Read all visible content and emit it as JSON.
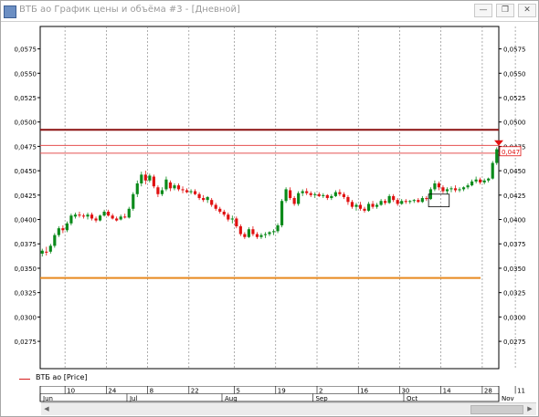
{
  "window": {
    "title": "ВТБ ао График цены и объёма #3 - [Дневной]",
    "buttons": {
      "min": "—",
      "restore": "❐",
      "close": "✕"
    }
  },
  "legend": {
    "label": "ВТБ ао [Price]"
  },
  "chart_data": {
    "type": "candlestick",
    "series_name": "ВТБ ао [Price]",
    "ylim": [
      0.0247,
      0.0598
    ],
    "y_ticks": [
      {
        "v": 0.0575,
        "label": "0,0575"
      },
      {
        "v": 0.055,
        "label": "0,0550"
      },
      {
        "v": 0.0525,
        "label": "0,0525"
      },
      {
        "v": 0.05,
        "label": "0,0500"
      },
      {
        "v": 0.0475,
        "label": "0,0475"
      },
      {
        "v": 0.045,
        "label": "0,0450"
      },
      {
        "v": 0.0425,
        "label": "0,0425"
      },
      {
        "v": 0.04,
        "label": "0,0400"
      },
      {
        "v": 0.0375,
        "label": "0,0375"
      },
      {
        "v": 0.035,
        "label": "0,0350"
      },
      {
        "v": 0.0325,
        "label": "0,0325"
      },
      {
        "v": 0.03,
        "label": "0,0300"
      },
      {
        "v": 0.0275,
        "label": "0,0275"
      }
    ],
    "x_day_labels": [
      {
        "i": 6,
        "label": "10"
      },
      {
        "i": 16,
        "label": "24"
      },
      {
        "i": 26,
        "label": "8"
      },
      {
        "i": 36,
        "label": "22"
      },
      {
        "i": 47,
        "label": "5"
      },
      {
        "i": 57,
        "label": "19"
      },
      {
        "i": 67,
        "label": "2"
      },
      {
        "i": 77,
        "label": "16"
      },
      {
        "i": 87,
        "label": "30"
      },
      {
        "i": 97,
        "label": "14"
      },
      {
        "i": 107,
        "label": "28"
      },
      {
        "i": 115,
        "label": "11"
      }
    ],
    "x_month_labels": [
      {
        "i": 0,
        "label": "Jun"
      },
      {
        "i": 21,
        "label": "Jul"
      },
      {
        "i": 44,
        "label": "Aug"
      },
      {
        "i": 66,
        "label": "Sep"
      },
      {
        "i": 88,
        "label": "Oct"
      },
      {
        "i": 111,
        "label": "Nov"
      }
    ],
    "hlines": [
      {
        "value": 0.0492,
        "color": "#8b1010",
        "width": 2
      },
      {
        "value": 0.0476,
        "color": "#e45050",
        "width": 1
      },
      {
        "value": 0.0468,
        "color": "#e45050",
        "width": 1
      },
      {
        "value": 0.034,
        "color": "#e8891e",
        "width": 2
      }
    ],
    "last_price_label": "0,047",
    "last_price_value": 0.047,
    "up_color": "#0a8a1a",
    "down_color": "#e01010",
    "selection_box": {
      "i_start": 94,
      "i_end": 99,
      "y_low": 0.0413,
      "y_high": 0.0426
    },
    "candles": [
      {
        "o": 0.0365,
        "h": 0.037,
        "l": 0.0362,
        "c": 0.0368
      },
      {
        "o": 0.0367,
        "h": 0.0372,
        "l": 0.0363,
        "c": 0.0366
      },
      {
        "o": 0.0367,
        "h": 0.0375,
        "l": 0.0365,
        "c": 0.0373
      },
      {
        "o": 0.0373,
        "h": 0.0386,
        "l": 0.0371,
        "c": 0.0384
      },
      {
        "o": 0.0384,
        "h": 0.0393,
        "l": 0.0382,
        "c": 0.0391
      },
      {
        "o": 0.0391,
        "h": 0.0394,
        "l": 0.0386,
        "c": 0.0389
      },
      {
        "o": 0.0389,
        "h": 0.0398,
        "l": 0.0387,
        "c": 0.0396
      },
      {
        "o": 0.0396,
        "h": 0.0406,
        "l": 0.0394,
        "c": 0.0404
      },
      {
        "o": 0.0403,
        "h": 0.0407,
        "l": 0.0401,
        "c": 0.0405
      },
      {
        "o": 0.0405,
        "h": 0.0408,
        "l": 0.0402,
        "c": 0.0404
      },
      {
        "o": 0.0404,
        "h": 0.0406,
        "l": 0.0401,
        "c": 0.0403
      },
      {
        "o": 0.0403,
        "h": 0.0407,
        "l": 0.04,
        "c": 0.0405
      },
      {
        "o": 0.0405,
        "h": 0.0407,
        "l": 0.0399,
        "c": 0.0401
      },
      {
        "o": 0.0401,
        "h": 0.0403,
        "l": 0.0397,
        "c": 0.0399
      },
      {
        "o": 0.0399,
        "h": 0.0405,
        "l": 0.0398,
        "c": 0.0404
      },
      {
        "o": 0.0404,
        "h": 0.041,
        "l": 0.0403,
        "c": 0.0408
      },
      {
        "o": 0.0408,
        "h": 0.041,
        "l": 0.0403,
        "c": 0.0404
      },
      {
        "o": 0.0404,
        "h": 0.0406,
        "l": 0.04,
        "c": 0.0401
      },
      {
        "o": 0.0401,
        "h": 0.0403,
        "l": 0.0398,
        "c": 0.0399
      },
      {
        "o": 0.04,
        "h": 0.0405,
        "l": 0.0399,
        "c": 0.0403
      },
      {
        "o": 0.0403,
        "h": 0.0406,
        "l": 0.0401,
        "c": 0.0402
      },
      {
        "o": 0.0402,
        "h": 0.0413,
        "l": 0.0401,
        "c": 0.0411
      },
      {
        "o": 0.0411,
        "h": 0.0428,
        "l": 0.0409,
        "c": 0.0426
      },
      {
        "o": 0.0426,
        "h": 0.044,
        "l": 0.0423,
        "c": 0.0437
      },
      {
        "o": 0.0437,
        "h": 0.0449,
        "l": 0.0434,
        "c": 0.0446
      },
      {
        "o": 0.0446,
        "h": 0.045,
        "l": 0.0436,
        "c": 0.044
      },
      {
        "o": 0.044,
        "h": 0.0447,
        "l": 0.0438,
        "c": 0.0445
      },
      {
        "o": 0.0444,
        "h": 0.0446,
        "l": 0.0432,
        "c": 0.0434
      },
      {
        "o": 0.0433,
        "h": 0.0435,
        "l": 0.0423,
        "c": 0.0426
      },
      {
        "o": 0.0426,
        "h": 0.0433,
        "l": 0.0424,
        "c": 0.043
      },
      {
        "o": 0.0431,
        "h": 0.0444,
        "l": 0.0429,
        "c": 0.0441
      },
      {
        "o": 0.0438,
        "h": 0.044,
        "l": 0.0429,
        "c": 0.0432
      },
      {
        "o": 0.0432,
        "h": 0.0437,
        "l": 0.043,
        "c": 0.0435
      },
      {
        "o": 0.0435,
        "h": 0.0437,
        "l": 0.0429,
        "c": 0.0431
      },
      {
        "o": 0.0431,
        "h": 0.0434,
        "l": 0.0427,
        "c": 0.043
      },
      {
        "o": 0.043,
        "h": 0.0432,
        "l": 0.0427,
        "c": 0.0428
      },
      {
        "o": 0.0428,
        "h": 0.0431,
        "l": 0.0426,
        "c": 0.0429
      },
      {
        "o": 0.0429,
        "h": 0.0431,
        "l": 0.0425,
        "c": 0.0426
      },
      {
        "o": 0.0426,
        "h": 0.0428,
        "l": 0.042,
        "c": 0.0422
      },
      {
        "o": 0.0422,
        "h": 0.0425,
        "l": 0.0418,
        "c": 0.042
      },
      {
        "o": 0.042,
        "h": 0.0424,
        "l": 0.0417,
        "c": 0.0423
      },
      {
        "o": 0.042,
        "h": 0.0422,
        "l": 0.0413,
        "c": 0.0415
      },
      {
        "o": 0.0415,
        "h": 0.0417,
        "l": 0.0409,
        "c": 0.0411
      },
      {
        "o": 0.0411,
        "h": 0.0413,
        "l": 0.0406,
        "c": 0.0408
      },
      {
        "o": 0.0408,
        "h": 0.041,
        "l": 0.0403,
        "c": 0.0405
      },
      {
        "o": 0.0405,
        "h": 0.0407,
        "l": 0.0398,
        "c": 0.04
      },
      {
        "o": 0.04,
        "h": 0.0404,
        "l": 0.0396,
        "c": 0.0401
      },
      {
        "o": 0.0401,
        "h": 0.0403,
        "l": 0.0391,
        "c": 0.0393
      },
      {
        "o": 0.0393,
        "h": 0.0395,
        "l": 0.0383,
        "c": 0.0385
      },
      {
        "o": 0.0385,
        "h": 0.0387,
        "l": 0.038,
        "c": 0.0382
      },
      {
        "o": 0.0382,
        "h": 0.0392,
        "l": 0.0381,
        "c": 0.039
      },
      {
        "o": 0.039,
        "h": 0.0393,
        "l": 0.0383,
        "c": 0.0385
      },
      {
        "o": 0.0385,
        "h": 0.0387,
        "l": 0.038,
        "c": 0.0382
      },
      {
        "o": 0.0382,
        "h": 0.0386,
        "l": 0.038,
        "c": 0.0384
      },
      {
        "o": 0.0384,
        "h": 0.0387,
        "l": 0.0381,
        "c": 0.0385
      },
      {
        "o": 0.0385,
        "h": 0.0388,
        "l": 0.0383,
        "c": 0.0387
      },
      {
        "o": 0.0387,
        "h": 0.039,
        "l": 0.0384,
        "c": 0.0388
      },
      {
        "o": 0.0388,
        "h": 0.0396,
        "l": 0.0386,
        "c": 0.0394
      },
      {
        "o": 0.0394,
        "h": 0.0421,
        "l": 0.0392,
        "c": 0.0419
      },
      {
        "o": 0.0419,
        "h": 0.0433,
        "l": 0.0417,
        "c": 0.0431
      },
      {
        "o": 0.043,
        "h": 0.0433,
        "l": 0.042,
        "c": 0.0422
      },
      {
        "o": 0.0422,
        "h": 0.0424,
        "l": 0.0414,
        "c": 0.0416
      },
      {
        "o": 0.0416,
        "h": 0.0429,
        "l": 0.0414,
        "c": 0.0427
      },
      {
        "o": 0.0427,
        "h": 0.0431,
        "l": 0.0424,
        "c": 0.0429
      },
      {
        "o": 0.0429,
        "h": 0.0432,
        "l": 0.0425,
        "c": 0.0427
      },
      {
        "o": 0.0427,
        "h": 0.0429,
        "l": 0.0423,
        "c": 0.0425
      },
      {
        "o": 0.0425,
        "h": 0.0428,
        "l": 0.0422,
        "c": 0.0426
      },
      {
        "o": 0.0426,
        "h": 0.0428,
        "l": 0.0423,
        "c": 0.0424
      },
      {
        "o": 0.0424,
        "h": 0.0427,
        "l": 0.0422,
        "c": 0.0425
      },
      {
        "o": 0.0425,
        "h": 0.0426,
        "l": 0.042,
        "c": 0.0422
      },
      {
        "o": 0.0422,
        "h": 0.0426,
        "l": 0.042,
        "c": 0.0424
      },
      {
        "o": 0.0424,
        "h": 0.043,
        "l": 0.0423,
        "c": 0.0428
      },
      {
        "o": 0.0428,
        "h": 0.0431,
        "l": 0.0424,
        "c": 0.0426
      },
      {
        "o": 0.0426,
        "h": 0.0428,
        "l": 0.0421,
        "c": 0.0423
      },
      {
        "o": 0.0423,
        "h": 0.0425,
        "l": 0.0415,
        "c": 0.0418
      },
      {
        "o": 0.0418,
        "h": 0.042,
        "l": 0.0411,
        "c": 0.0413
      },
      {
        "o": 0.0413,
        "h": 0.0417,
        "l": 0.0409,
        "c": 0.0415
      },
      {
        "o": 0.0415,
        "h": 0.0418,
        "l": 0.0409,
        "c": 0.0411
      },
      {
        "o": 0.0411,
        "h": 0.0413,
        "l": 0.0407,
        "c": 0.0409
      },
      {
        "o": 0.0409,
        "h": 0.0418,
        "l": 0.0408,
        "c": 0.0416
      },
      {
        "o": 0.0416,
        "h": 0.0419,
        "l": 0.0411,
        "c": 0.0413
      },
      {
        "o": 0.0413,
        "h": 0.0417,
        "l": 0.0411,
        "c": 0.0415
      },
      {
        "o": 0.0415,
        "h": 0.0421,
        "l": 0.0414,
        "c": 0.0419
      },
      {
        "o": 0.0419,
        "h": 0.0421,
        "l": 0.0415,
        "c": 0.0417
      },
      {
        "o": 0.0417,
        "h": 0.0426,
        "l": 0.0416,
        "c": 0.0424
      },
      {
        "o": 0.0424,
        "h": 0.0426,
        "l": 0.0418,
        "c": 0.042
      },
      {
        "o": 0.042,
        "h": 0.0422,
        "l": 0.0414,
        "c": 0.0416
      },
      {
        "o": 0.0416,
        "h": 0.0421,
        "l": 0.0415,
        "c": 0.0419
      },
      {
        "o": 0.0419,
        "h": 0.0421,
        "l": 0.0416,
        "c": 0.0418
      },
      {
        "o": 0.0418,
        "h": 0.042,
        "l": 0.0416,
        "c": 0.0419
      },
      {
        "o": 0.0419,
        "h": 0.0421,
        "l": 0.0417,
        "c": 0.042
      },
      {
        "o": 0.042,
        "h": 0.0422,
        "l": 0.0417,
        "c": 0.0418
      },
      {
        "o": 0.0418,
        "h": 0.0424,
        "l": 0.0417,
        "c": 0.0422
      },
      {
        "o": 0.0422,
        "h": 0.0424,
        "l": 0.0419,
        "c": 0.0421
      },
      {
        "o": 0.0421,
        "h": 0.0433,
        "l": 0.042,
        "c": 0.0431
      },
      {
        "o": 0.0431,
        "h": 0.044,
        "l": 0.0429,
        "c": 0.0437
      },
      {
        "o": 0.0437,
        "h": 0.0439,
        "l": 0.043,
        "c": 0.0433
      },
      {
        "o": 0.0433,
        "h": 0.0435,
        "l": 0.0427,
        "c": 0.0429
      },
      {
        "o": 0.0429,
        "h": 0.0433,
        "l": 0.0426,
        "c": 0.0431
      },
      {
        "o": 0.0431,
        "h": 0.0434,
        "l": 0.0428,
        "c": 0.0432
      },
      {
        "o": 0.0432,
        "h": 0.0435,
        "l": 0.0428,
        "c": 0.043
      },
      {
        "o": 0.043,
        "h": 0.0433,
        "l": 0.0428,
        "c": 0.0431
      },
      {
        "o": 0.0431,
        "h": 0.0434,
        "l": 0.0429,
        "c": 0.0433
      },
      {
        "o": 0.0433,
        "h": 0.0437,
        "l": 0.0431,
        "c": 0.0435
      },
      {
        "o": 0.0435,
        "h": 0.0441,
        "l": 0.0434,
        "c": 0.0439
      },
      {
        "o": 0.0439,
        "h": 0.0444,
        "l": 0.0437,
        "c": 0.0441
      },
      {
        "o": 0.0441,
        "h": 0.0443,
        "l": 0.0436,
        "c": 0.0438
      },
      {
        "o": 0.0438,
        "h": 0.0442,
        "l": 0.0436,
        "c": 0.044
      },
      {
        "o": 0.044,
        "h": 0.0443,
        "l": 0.0438,
        "c": 0.0442
      },
      {
        "o": 0.0442,
        "h": 0.046,
        "l": 0.0441,
        "c": 0.0458
      },
      {
        "o": 0.0458,
        "h": 0.0474,
        "l": 0.0456,
        "c": 0.0472
      }
    ]
  }
}
